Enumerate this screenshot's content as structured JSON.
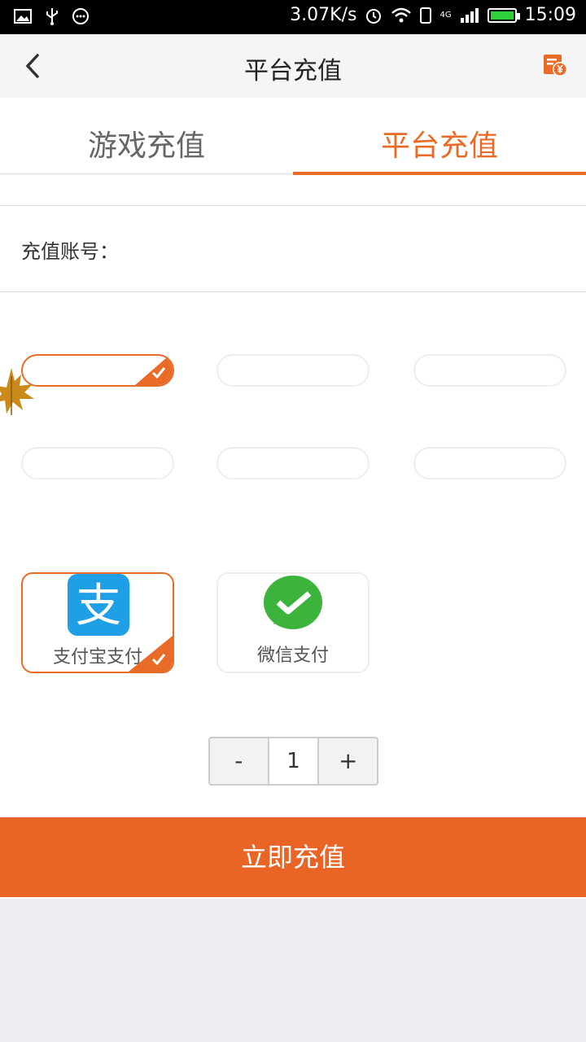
{
  "status_bar": {
    "net_speed": "3.07K/s",
    "network_type": "4G",
    "time": "15:09",
    "battery_level": 1.0,
    "icons": [
      "image-icon",
      "usb-icon",
      "more-icon",
      "alarm-icon",
      "wifi-icon",
      "sim-icon",
      "signal-icon",
      "battery-icon"
    ]
  },
  "header": {
    "title": "平台充值",
    "back_icon": "chevron-left-icon",
    "right_icon": "recharge-record-icon"
  },
  "tabs": [
    {
      "label": "游戏充值",
      "active": false
    },
    {
      "label": "平台充值",
      "active": true
    }
  ],
  "account": {
    "label": "充值账号：",
    "value": "",
    "placeholder": ""
  },
  "amount_options": [
    {
      "label": "",
      "selected": true
    },
    {
      "label": "",
      "selected": false
    },
    {
      "label": "",
      "selected": false
    },
    {
      "label": "",
      "selected": false
    },
    {
      "label": "",
      "selected": false
    },
    {
      "label": "",
      "selected": false
    }
  ],
  "payment_methods": [
    {
      "label": "支付宝支付",
      "icon": "alipay-icon",
      "selected": true
    },
    {
      "label": "微信支付",
      "icon": "wechat-pay-icon",
      "selected": false
    }
  ],
  "quantity": {
    "minus_label": "-",
    "value": "1",
    "plus_label": "+"
  },
  "submit_label": "立即充值",
  "colors": {
    "accent": "#e96b28",
    "submit": "#e96425",
    "alipay": "#1fa0e6",
    "wechat": "#3cb43c"
  }
}
